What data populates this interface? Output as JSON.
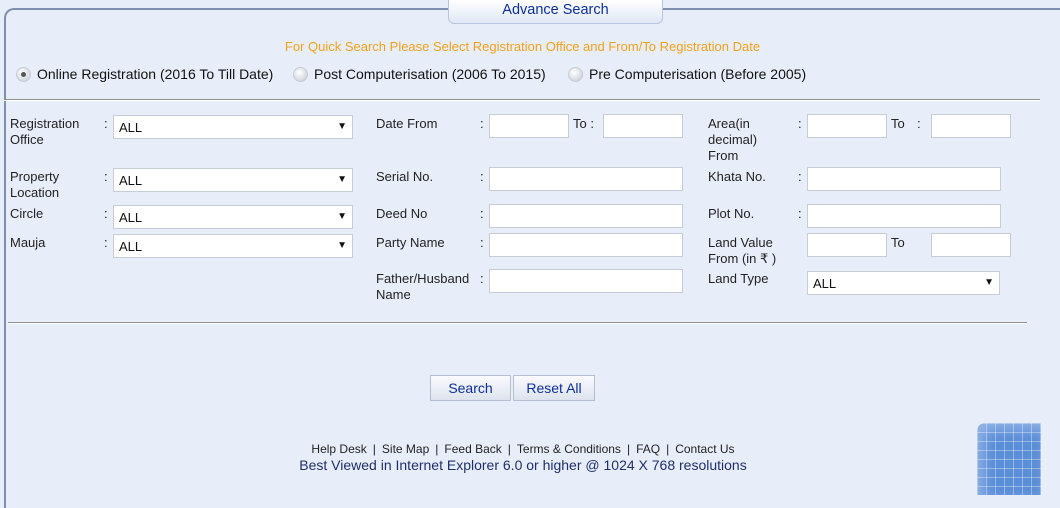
{
  "legend": {
    "title": "Advance Search"
  },
  "notice": "For Quick Search Please Select Registration Office and From/To Registration Date",
  "registration_types": [
    {
      "label": "Online Registration (2016 To Till Date)",
      "selected": true
    },
    {
      "label": "Post Computerisation (2006 To 2015)",
      "selected": false
    },
    {
      "label": "Pre Computerisation (Before 2005)",
      "selected": false
    }
  ],
  "form": {
    "registration_office": {
      "label": "Registration Office",
      "value": "ALL"
    },
    "property_location": {
      "label": "Property Location",
      "value": "ALL"
    },
    "circle": {
      "label": "Circle",
      "value": "ALL"
    },
    "mauja": {
      "label": "Mauja",
      "value": "ALL"
    },
    "date_from": {
      "label": "Date From",
      "to_label": "To :",
      "value": "",
      "to_value": ""
    },
    "serial_no": {
      "label": "Serial No.",
      "value": ""
    },
    "deed_no": {
      "label": "Deed No",
      "value": ""
    },
    "party_name": {
      "label": "Party Name",
      "value": ""
    },
    "father_husband_name": {
      "label": "Father/Husband Name",
      "value": ""
    },
    "area": {
      "label": "Area(in decimal) From",
      "to_label": "To",
      "value": "",
      "to_value": ""
    },
    "khata_no": {
      "label": "Khata No.",
      "value": ""
    },
    "plot_no": {
      "label": "Plot No.",
      "value": ""
    },
    "land_value": {
      "label": "Land Value From (in ₹ )",
      "to_label": "To",
      "value": "",
      "to_value": ""
    },
    "land_type": {
      "label": "Land Type",
      "value": "ALL"
    },
    "colon": ":"
  },
  "buttons": {
    "search": "Search",
    "reset": "Reset All"
  },
  "footer": {
    "links": [
      "Help Desk",
      "Site Map",
      "Feed Back",
      "Terms & Conditions",
      "FAQ",
      "Contact Us"
    ],
    "separator": "|",
    "note": "Best Viewed in Internet Explorer 6.0 or higher @ 1024 X 768 resolutions"
  },
  "icons": {
    "dropdown": "▼"
  },
  "colors": {
    "notice": "#f2a21a",
    "button_text": "#0d2f9b",
    "background": "#e8eef9"
  }
}
